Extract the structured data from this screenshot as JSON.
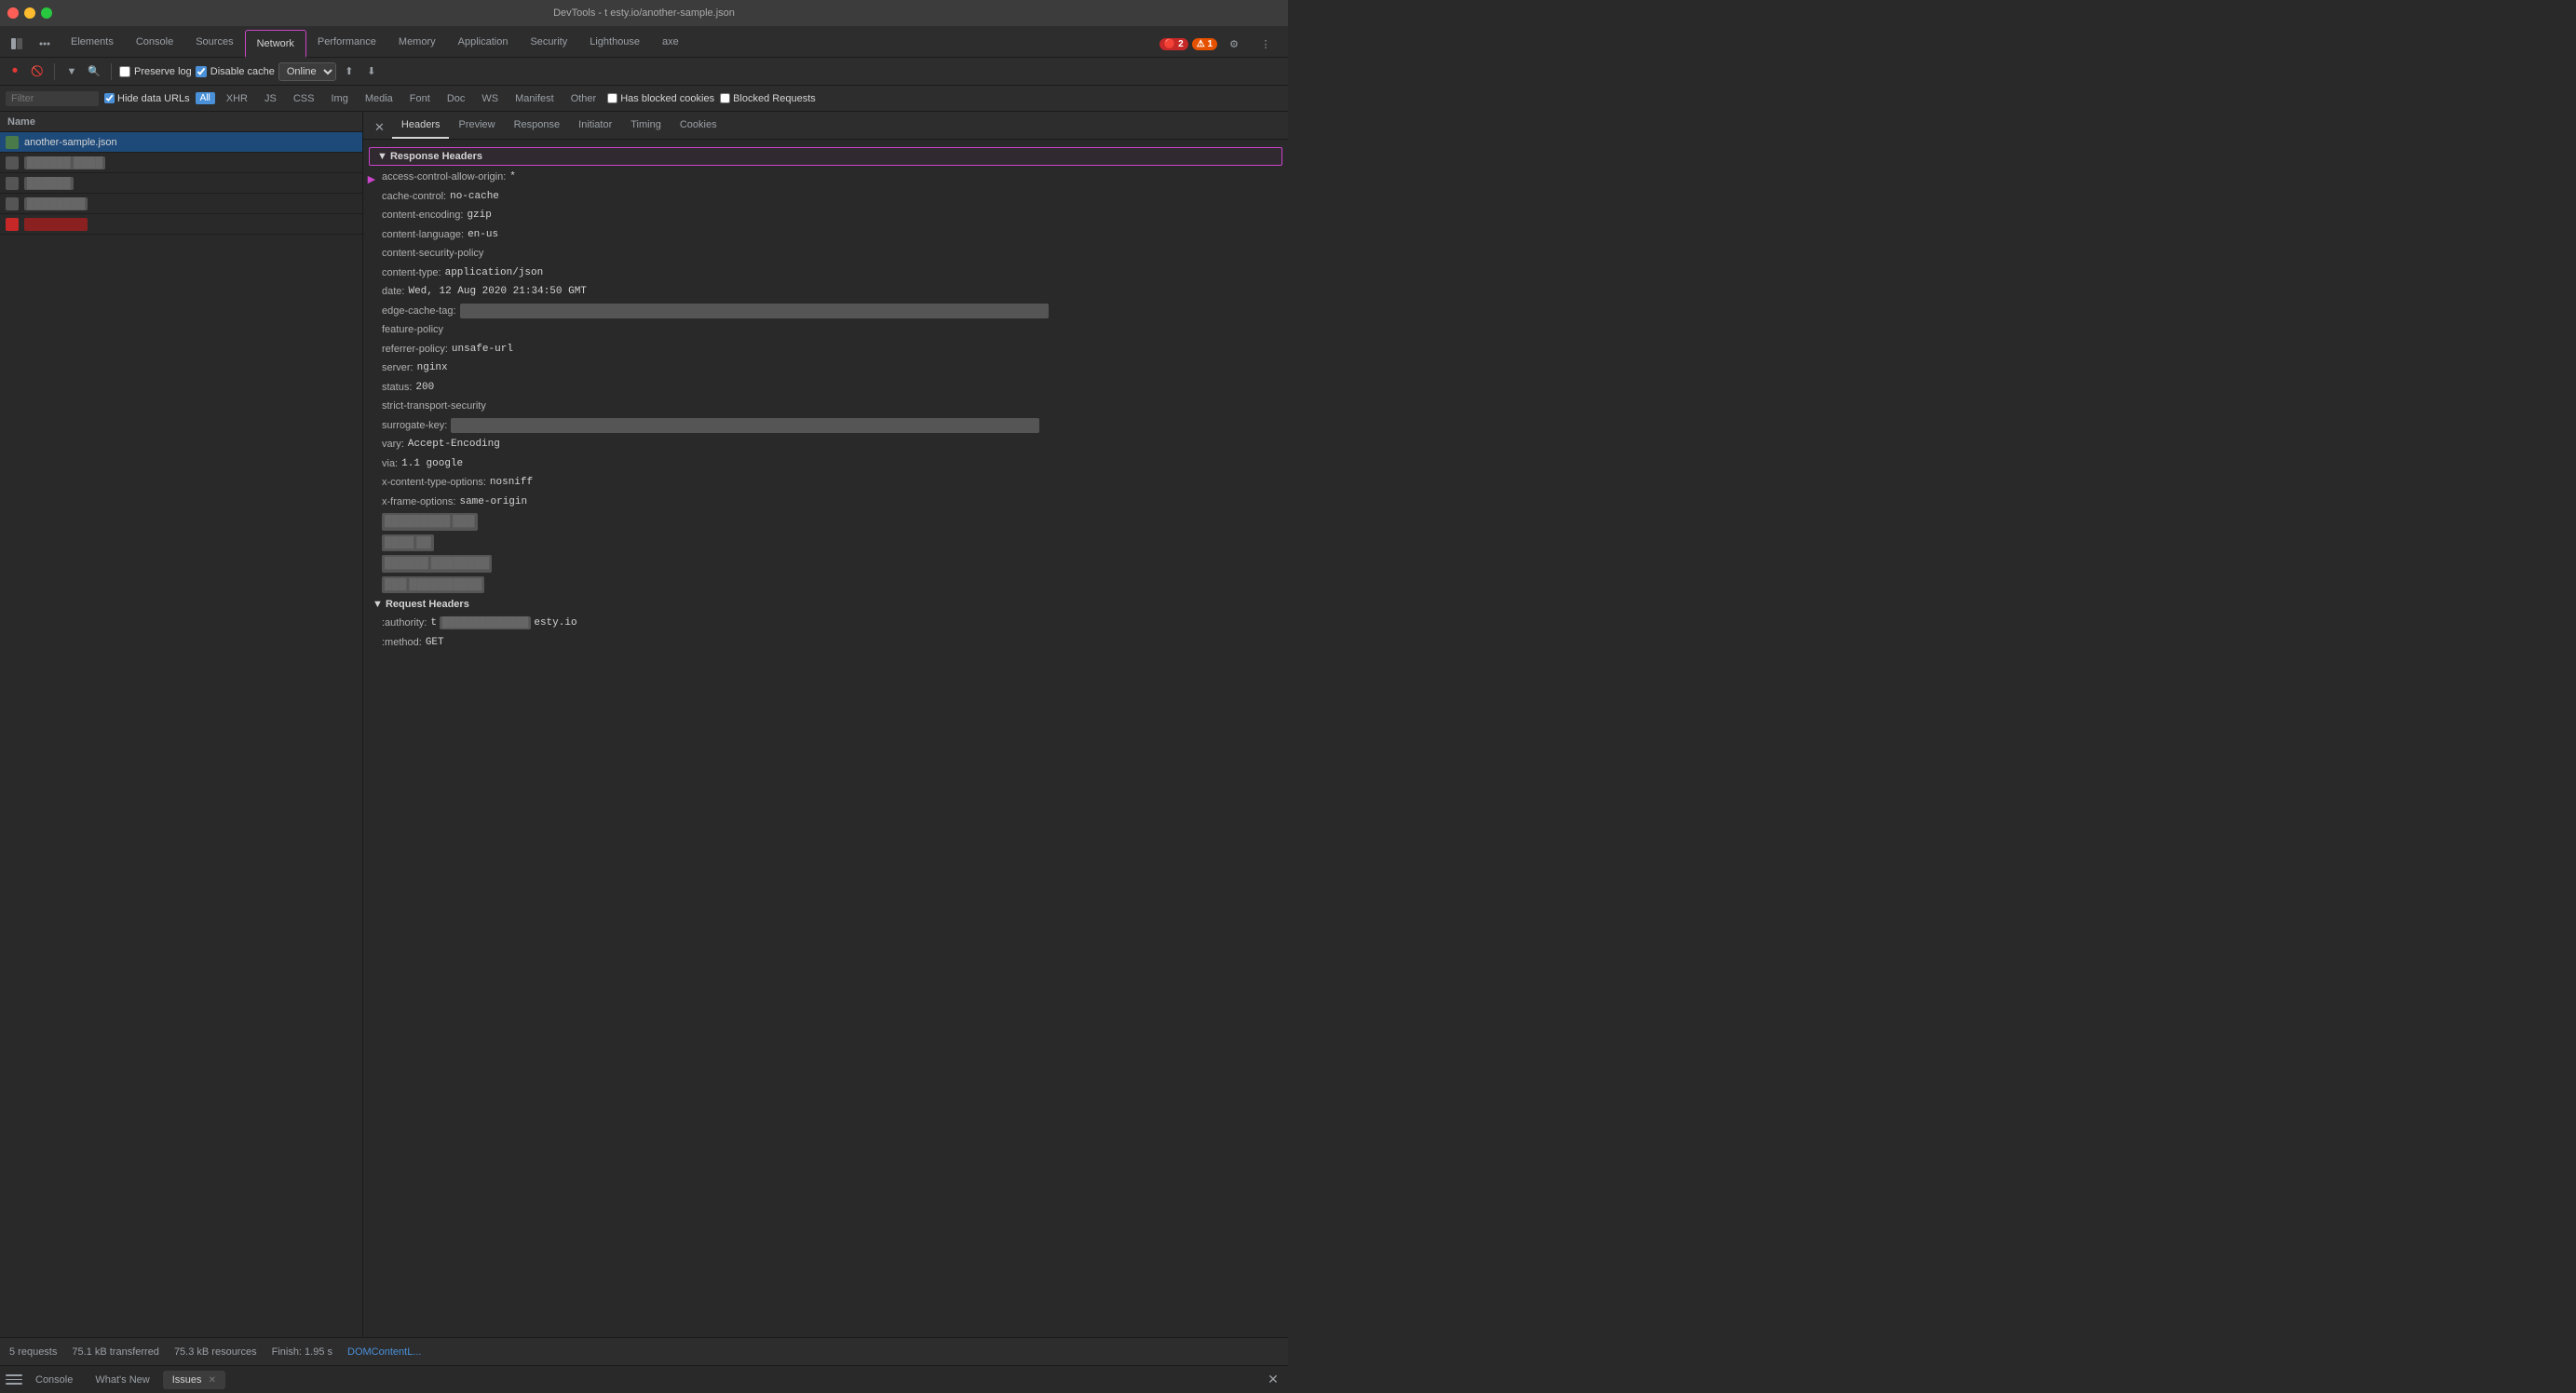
{
  "titleBar": {
    "title": "DevTools - t esty.io/another-sample.json"
  },
  "tabs": {
    "items": [
      {
        "label": "Elements",
        "active": false
      },
      {
        "label": "Console",
        "active": false
      },
      {
        "label": "Sources",
        "active": false
      },
      {
        "label": "Network",
        "active": true
      },
      {
        "label": "Performance",
        "active": false
      },
      {
        "label": "Memory",
        "active": false
      },
      {
        "label": "Application",
        "active": false
      },
      {
        "label": "Security",
        "active": false
      },
      {
        "label": "Lighthouse",
        "active": false
      },
      {
        "label": "axe",
        "active": false
      }
    ],
    "errorBadge": "2",
    "warnBadge": "1"
  },
  "networkToolbar": {
    "preserveLog": "Preserve log",
    "disableCache": "Disable cache",
    "onlineOption": "Online"
  },
  "filterBar": {
    "placeholder": "Filter",
    "hideDataURLs": "Hide data URLs",
    "allChip": "All",
    "types": [
      "XHR",
      "JS",
      "CSS",
      "Img",
      "Media",
      "Font",
      "Doc",
      "WS",
      "Manifest",
      "Other"
    ],
    "hasBlockedCookies": "Has blocked cookies",
    "blockedRequests": "Blocked Requests"
  },
  "networkList": {
    "header": "Name",
    "items": [
      {
        "name": "another-sample.json",
        "type": "json",
        "selected": true
      },
      {
        "name": "blurred-1",
        "type": "blurred"
      },
      {
        "name": "blurred-2",
        "type": "blurred"
      },
      {
        "name": "blurred-3",
        "type": "blurred"
      },
      {
        "name": "blurred-4",
        "type": "red"
      }
    ]
  },
  "detailTabs": {
    "items": [
      "Headers",
      "Preview",
      "Response",
      "Initiator",
      "Timing",
      "Cookies"
    ],
    "active": "Headers"
  },
  "responseHeaders": {
    "sectionLabel": "▼ Response Headers",
    "highlighted": true,
    "arrowIndicator": "►",
    "headers": [
      {
        "name": "access-control-allow-origin:",
        "value": "*",
        "highlight": true
      },
      {
        "name": "cache-control:",
        "value": "no-cache"
      },
      {
        "name": "content-encoding:",
        "value": "gzip"
      },
      {
        "name": "content-language:",
        "value": "en-us"
      },
      {
        "name": "content-security-policy",
        "value": ""
      },
      {
        "name": "content-type:",
        "value": "application/json"
      },
      {
        "name": "date:",
        "value": "Wed, 12 Aug 2020 21:34:50 GMT"
      },
      {
        "name": "edge-cache-tag:",
        "value": "[blurred long value]",
        "blurred": true
      },
      {
        "name": "feature-policy",
        "value": ""
      },
      {
        "name": "referrer-policy:",
        "value": "unsafe-url"
      },
      {
        "name": "server:",
        "value": "nginx"
      },
      {
        "name": "status:",
        "value": "200"
      },
      {
        "name": "strict-transport-security",
        "value": ""
      },
      {
        "name": "surrogate-key:",
        "value": "[blurred long value]",
        "blurred": true
      },
      {
        "name": "vary:",
        "value": "Accept-Encoding"
      },
      {
        "name": "via:",
        "value": "1.1 google"
      },
      {
        "name": "x-content-type-options:",
        "value": "nosniff"
      },
      {
        "name": "x-frame-options:",
        "value": "same-origin"
      },
      {
        "name": "blurred-row-1",
        "value": "[blurred]",
        "blurred": true,
        "fullBlur": true
      },
      {
        "name": "blurred-row-2",
        "value": "[blurred]",
        "blurred": true,
        "fullBlur": true
      },
      {
        "name": "blurred-row-3",
        "value": "[blurred]",
        "blurred": true,
        "fullBlur": true
      },
      {
        "name": "blurred-row-4",
        "value": "[blurred]",
        "blurred": true,
        "fullBlur": true
      }
    ]
  },
  "requestHeaders": {
    "sectionLabel": "▼ Request Headers",
    "headers": [
      {
        "name": ":authority:",
        "value": "t esty.io",
        "blurred": true
      },
      {
        "name": ":method:",
        "value": "GET"
      }
    ]
  },
  "statusBar": {
    "requests": "5 requests",
    "transferred": "75.1 kB transferred",
    "resources": "75.3 kB resources",
    "finish": "Finish: 1.95 s",
    "domContent": "DOMContentL..."
  },
  "bottomBar": {
    "tabs": [
      {
        "label": "Console",
        "active": false
      },
      {
        "label": "What's New",
        "active": false
      },
      {
        "label": "Issues",
        "active": true,
        "closeable": true
      }
    ]
  }
}
